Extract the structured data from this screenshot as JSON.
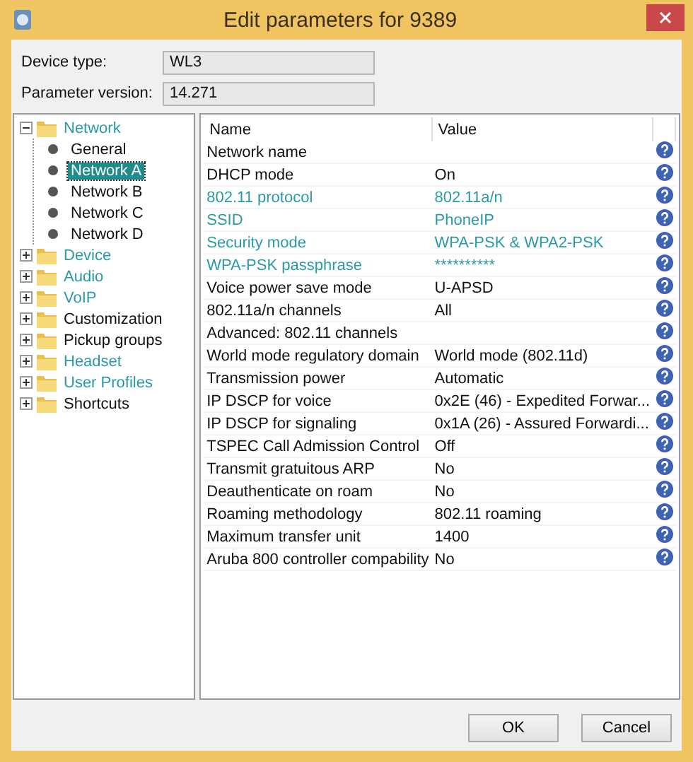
{
  "window": {
    "title": "Edit parameters for 9389"
  },
  "fields": [
    {
      "label": "Device type:",
      "value": "WL3"
    },
    {
      "label": "Parameter version:",
      "value": "14.271"
    }
  ],
  "tree": [
    {
      "label": "Network",
      "modified": true,
      "expanded": true,
      "selected": false,
      "children": [
        {
          "label": "General",
          "selected": false,
          "modified": false
        },
        {
          "label": "Network A",
          "selected": true,
          "modified": false
        },
        {
          "label": "Network B",
          "selected": false,
          "modified": false
        },
        {
          "label": "Network C",
          "selected": false,
          "modified": false
        },
        {
          "label": "Network D",
          "selected": false,
          "modified": false
        }
      ]
    },
    {
      "label": "Device",
      "modified": true,
      "expanded": false,
      "selected": false
    },
    {
      "label": "Audio",
      "modified": true,
      "expanded": false,
      "selected": false
    },
    {
      "label": "VoIP",
      "modified": true,
      "expanded": false,
      "selected": false
    },
    {
      "label": "Customization",
      "modified": false,
      "expanded": false,
      "selected": false
    },
    {
      "label": "Pickup groups",
      "modified": false,
      "expanded": false,
      "selected": false
    },
    {
      "label": "Headset",
      "modified": true,
      "expanded": false,
      "selected": false
    },
    {
      "label": "User Profiles",
      "modified": true,
      "expanded": false,
      "selected": false
    },
    {
      "label": "Shortcuts",
      "modified": false,
      "expanded": false,
      "selected": false
    }
  ],
  "table": {
    "columns": [
      "Name",
      "Value"
    ],
    "rows": [
      {
        "name": "Network name",
        "value": "",
        "modified": false
      },
      {
        "name": "DHCP mode",
        "value": "On",
        "modified": false
      },
      {
        "name": "802.11 protocol",
        "value": "802.11a/n",
        "modified": true
      },
      {
        "name": "SSID",
        "value": "PhoneIP",
        "modified": true
      },
      {
        "name": "Security mode",
        "value": "WPA-PSK & WPA2-PSK",
        "modified": true
      },
      {
        "name": "WPA-PSK passphrase",
        "value": "**********",
        "modified": true
      },
      {
        "name": "Voice power save mode",
        "value": "U-APSD",
        "modified": false
      },
      {
        "name": "802.11a/n channels",
        "value": "All",
        "modified": false
      },
      {
        "name": "Advanced: 802.11 channels",
        "value": "",
        "modified": false
      },
      {
        "name": "World mode regulatory domain",
        "value": "World mode (802.11d)",
        "modified": false
      },
      {
        "name": "Transmission power",
        "value": "Automatic",
        "modified": false
      },
      {
        "name": "IP DSCP for voice",
        "value": "0x2E (46) - Expedited Forwar...",
        "modified": false
      },
      {
        "name": "IP DSCP for signaling",
        "value": "0x1A (26) - Assured Forwardi...",
        "modified": false
      },
      {
        "name": "TSPEC Call Admission Control",
        "value": "Off",
        "modified": false
      },
      {
        "name": "Transmit gratuitous ARP",
        "value": "No",
        "modified": false
      },
      {
        "name": "Deauthenticate on roam",
        "value": "No",
        "modified": false
      },
      {
        "name": "Roaming methodology",
        "value": "802.11 roaming",
        "modified": false
      },
      {
        "name": "Maximum transfer unit",
        "value": "1400",
        "modified": false
      },
      {
        "name": "Aruba 800 controller compability",
        "value": "No",
        "modified": false
      }
    ]
  },
  "buttons": [
    "OK",
    "Cancel"
  ]
}
